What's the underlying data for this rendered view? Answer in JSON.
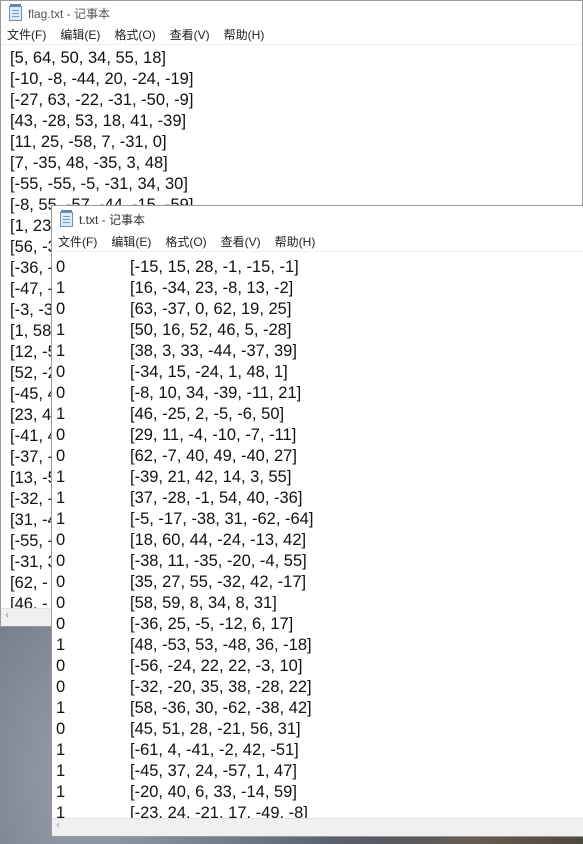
{
  "flag_window": {
    "title": "flag.txt - 记事本",
    "menu": [
      "文件(F)",
      "编辑(E)",
      "格式(O)",
      "查看(V)",
      "帮助(H)"
    ],
    "lines": [
      "[5, 64, 50, 34, 55, 18]",
      "[-10, -8, -44, 20, -24, -19]",
      "[-27, 63, -22, -31, -50, -9]",
      "[43, -28, 53, 18, 41, -39]",
      "[11, 25, -58, 7, -31, 0]",
      "[7, -35, 48, -35, 3, 48]",
      "[-55, -55, -5, -31, 34, 30]",
      "[-8, 55, -57, -44, -15, -59]",
      "[1, 23,",
      "[56, -3",
      "[-36, -",
      "[-47, -",
      "[-3, -3",
      "[1, 58,",
      "[12, -5",
      "[52, -2",
      "[-45, 4",
      "[23, 4",
      "[-41, 4",
      "[-37, -",
      "[13, -5",
      "[-32, -",
      "[31, -4",
      "[-55, -",
      "[-31, 3",
      "[62, -",
      "[46, -"
    ]
  },
  "t_window": {
    "title": "t.txt - 记事本",
    "menu": [
      "文件(F)",
      "编辑(E)",
      "格式(O)",
      "查看(V)",
      "帮助(H)"
    ],
    "rows": [
      {
        "label": "0",
        "vec": "[-15, 15, 28, -1, -15, -1]"
      },
      {
        "label": "1",
        "vec": "[16, -34, 23, -8, 13, -2]"
      },
      {
        "label": "0",
        "vec": "[63, -37, 0, 62, 19, 25]"
      },
      {
        "label": "1",
        "vec": "[50, 16, 52, 46, 5, -28]"
      },
      {
        "label": "1",
        "vec": "[38, 3, 33, -44, -37, 39]"
      },
      {
        "label": "0",
        "vec": "[-34, 15, -24, 1, 48, 1]"
      },
      {
        "label": "0",
        "vec": "[-8, 10, 34, -39, -11, 21]"
      },
      {
        "label": "1",
        "vec": "[46, -25, 2, -5, -6, 50]"
      },
      {
        "label": "0",
        "vec": "[29, 11, -4, -10, -7, -11]"
      },
      {
        "label": "0",
        "vec": "[62, -7, 40, 49, -40, 27]"
      },
      {
        "label": "1",
        "vec": "[-39, 21, 42, 14, 3, 55]"
      },
      {
        "label": "1",
        "vec": "[37, -28, -1, 54, 40, -36]"
      },
      {
        "label": "1",
        "vec": "[-5, -17, -38, 31, -62, -64]"
      },
      {
        "label": "0",
        "vec": "[18, 60, 44, -24, -13, 42]"
      },
      {
        "label": "0",
        "vec": "[-38, 11, -35, -20, -4, 55]"
      },
      {
        "label": "0",
        "vec": "[35, 27, 55, -32, 42, -17]"
      },
      {
        "label": "0",
        "vec": "[58, 59, 8, 34, 8, 31]"
      },
      {
        "label": "0",
        "vec": "[-36, 25, -5, -12, 6, 17]"
      },
      {
        "label": "1",
        "vec": "[48, -53, 53, -48, 36, -18]"
      },
      {
        "label": "0",
        "vec": "[-56, -24, 22, 22, -3, 10]"
      },
      {
        "label": "0",
        "vec": "[-32, -20, 35, 38, -28, 22]"
      },
      {
        "label": "1",
        "vec": "[58, -36, 30, -62, -38, 42]"
      },
      {
        "label": "0",
        "vec": "[45, 51, 28, -21, 56, 31]"
      },
      {
        "label": "1",
        "vec": "[-61, 4, -41, -2, 42, -51]"
      },
      {
        "label": "1",
        "vec": "[-45, 37, 24, -57, 1, 47]"
      },
      {
        "label": "1",
        "vec": "[-20, 40, 6, 33, -14, 59]"
      },
      {
        "label": "1",
        "vec": "[-23, 24, -21, 17, -49, -8]"
      }
    ]
  },
  "scroll_arrow_glyph": "‹"
}
